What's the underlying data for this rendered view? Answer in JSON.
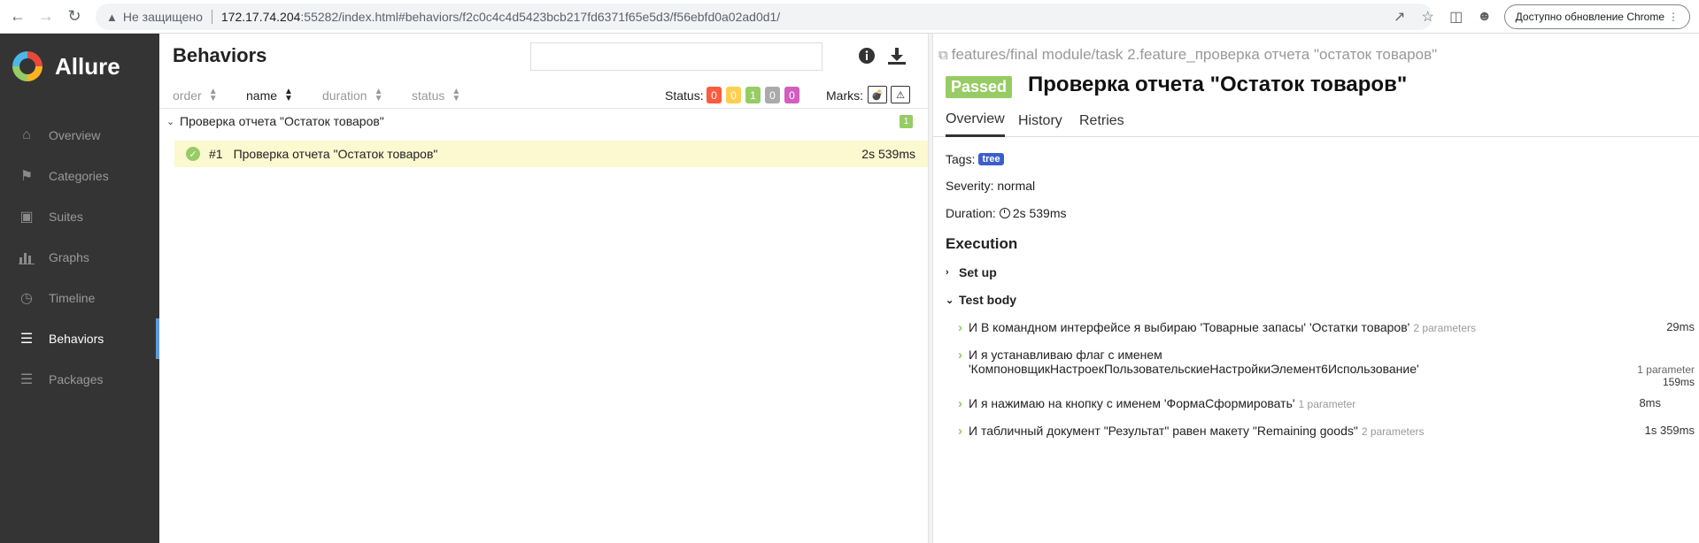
{
  "browser": {
    "insecure_label": "Не защищено",
    "url_host": "172.17.74.204",
    "url_rest": ":55282/index.html#behaviors/f2c0c4c4d5423bcb217fd6371f65e5d3/f56ebfd0a02ad0d1/",
    "update_label": "Доступно обновление Chrome"
  },
  "sidebar": {
    "brand": "Allure",
    "items": [
      {
        "label": "Overview",
        "icon": "home-icon"
      },
      {
        "label": "Categories",
        "icon": "flag-icon"
      },
      {
        "label": "Suites",
        "icon": "briefcase-icon"
      },
      {
        "label": "Graphs",
        "icon": "bar-chart-icon"
      },
      {
        "label": "Timeline",
        "icon": "clock-icon"
      },
      {
        "label": "Behaviors",
        "icon": "list-icon",
        "active": true
      },
      {
        "label": "Packages",
        "icon": "layers-icon"
      }
    ]
  },
  "behaviors": {
    "title": "Behaviors",
    "columns": [
      "order",
      "name",
      "duration",
      "status"
    ],
    "status_label": "Status:",
    "status_counts": [
      {
        "value": "0",
        "color": "#fd5a3e"
      },
      {
        "value": "0",
        "color": "#ffd050"
      },
      {
        "value": "1",
        "color": "#97cc64"
      },
      {
        "value": "0",
        "color": "#aaaaaa"
      },
      {
        "value": "0",
        "color": "#d35ebe"
      }
    ],
    "marks_label": "Marks:",
    "group": {
      "label": "Проверка отчета \"Остаток товаров\"",
      "count": "1"
    },
    "test": {
      "num": "#1",
      "name": "Проверка отчета \"Остаток товаров\"",
      "duration": "2s 539ms"
    }
  },
  "details": {
    "path": "features/final module/task 2.feature_проверка отчета \"остаток товаров\"",
    "status": "Passed",
    "title": "Проверка отчета \"Остаток товаров\"",
    "tabs": [
      "Overview",
      "History",
      "Retries"
    ],
    "tags_label": "Tags:",
    "tag": "tree",
    "severity": "Severity: normal",
    "duration_label": "Duration:",
    "duration": "2s 539ms",
    "execution": "Execution",
    "setup": "Set up",
    "test_body": "Test body",
    "steps": [
      {
        "text": "И В командном интерфейсе я выбираю 'Товарные запасы' 'Остатки товаров'",
        "params": "2 parameters",
        "duration": "29ms"
      },
      {
        "text_line1": "И я устанавливаю флаг с именем",
        "text_line2": "'КомпоновщикНастроекПользовательскиеНастройкиЭлемент6Использование'",
        "params": "1 parameter",
        "duration": "159ms"
      },
      {
        "text": "И я нажимаю на кнопку с именем 'ФормаСформировать'",
        "params": "1 parameter",
        "duration": "8ms"
      },
      {
        "text": "И табличный документ \"Результат\" равен макету \"Remaining goods\"",
        "params": "2 parameters",
        "duration": "1s 359ms"
      }
    ]
  }
}
